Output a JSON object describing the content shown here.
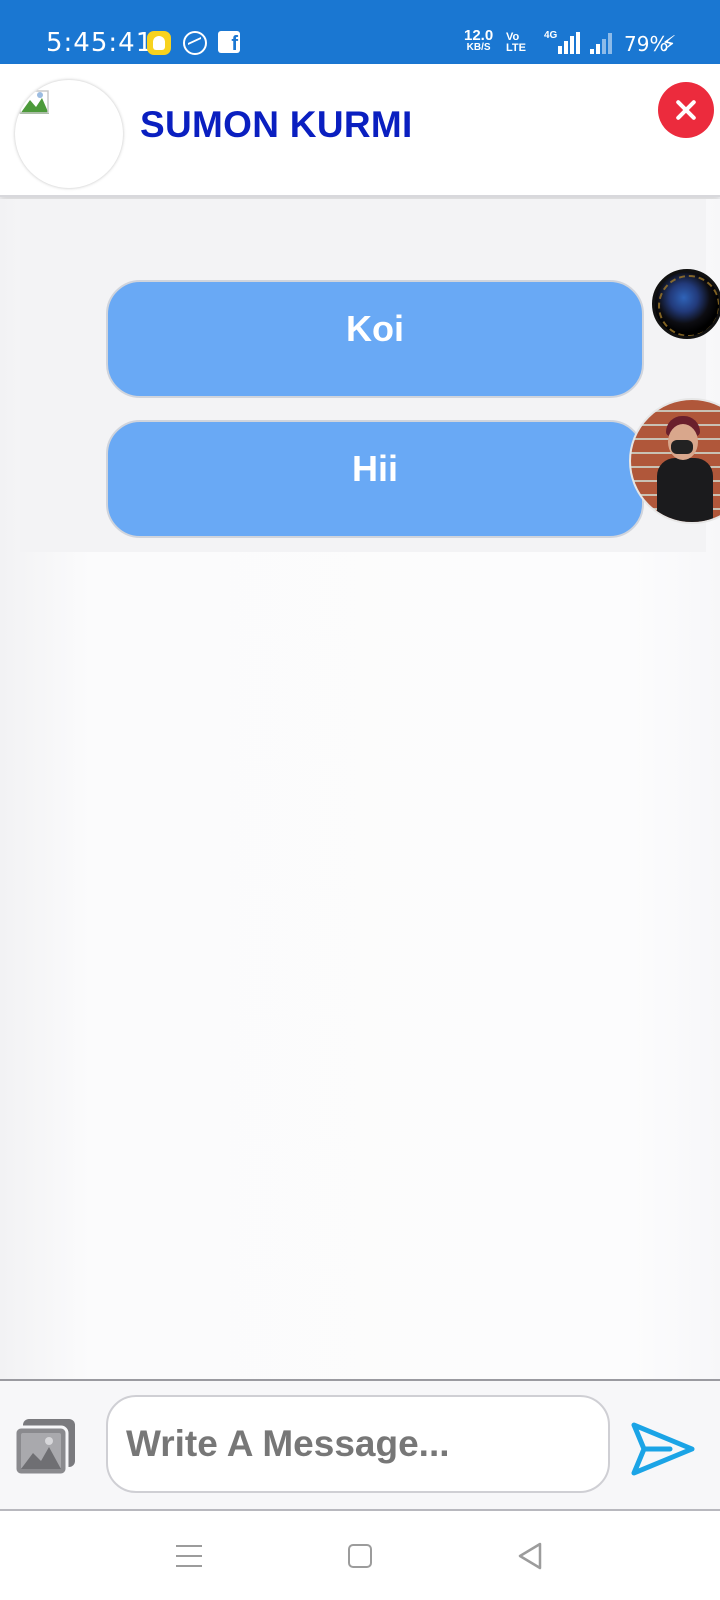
{
  "status_bar": {
    "time": "5:45:41",
    "net_speed_value": "12.0",
    "net_speed_unit": "KB/S",
    "volte_line1": "Vo",
    "volte_line2": "LTE",
    "network_type": "4G",
    "battery": "79%",
    "notification_icons": [
      "snapchat-icon",
      "messenger-icon",
      "facebook-icon"
    ]
  },
  "header": {
    "contact_name": "SUMON KURMI",
    "close_icon": "close-icon"
  },
  "messages": [
    {
      "text": "Koi",
      "avatar": "avatar-krishna"
    },
    {
      "text": "Hii",
      "avatar": "avatar-user-photo"
    }
  ],
  "composer": {
    "placeholder": "Write A Message...",
    "gallery_icon": "gallery-icon",
    "send_icon": "send-icon"
  },
  "colors": {
    "status_bar": "#1a77d2",
    "contact_name": "#0a1fc0",
    "bubble": "#69a9f5",
    "close_button": "#ec2b3d",
    "send_icon": "#1ba4e6"
  },
  "nav_bar": {
    "icons": [
      "menu-icon",
      "home-icon",
      "back-icon"
    ]
  }
}
